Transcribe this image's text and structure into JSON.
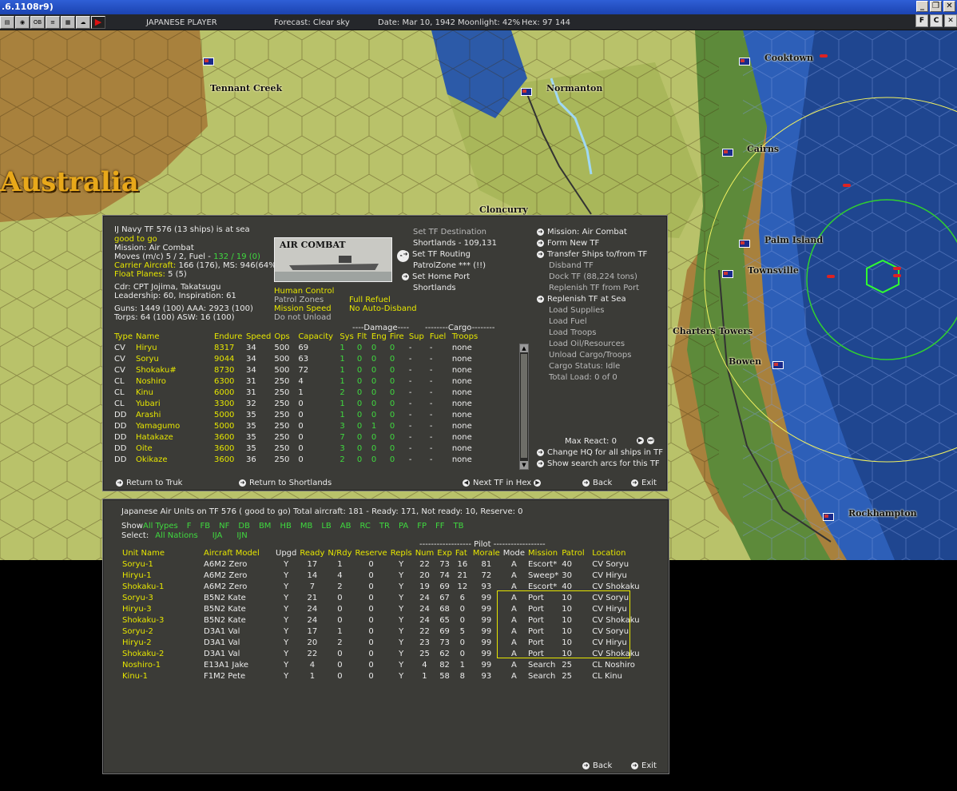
{
  "window": {
    "title": ".6.1108r9)",
    "buttons": [
      "_",
      "❐",
      "✕"
    ]
  },
  "toolbar": {
    "player": "JAPANESE PLAYER",
    "forecast": "Forecast: Clear sky",
    "date": "Date: Mar 10, 1942",
    "moonlight": "Moonlight: 42%",
    "hex": "Hex: 97 144",
    "right_buttons": [
      "F",
      "C",
      "✕"
    ]
  },
  "map": {
    "region_label": "Australia",
    "cities": [
      "Tennant Creek",
      "Normanton",
      "Cooktown",
      "Cairns",
      "Cloncurry",
      "Palm Island",
      "Townsville",
      "Charters Towers",
      "Bowen",
      "Rockhampton"
    ]
  },
  "tf": {
    "header": "IJ Navy TF 576 (13 ships) is at sea",
    "status": "good to go",
    "mission": "Mission: Air Combat",
    "moves_label": "Moves (m/c) 5 / 2, Fuel -",
    "moves_value": "132 / 19 (0)",
    "carrier_label": "Carrier Aircraft:",
    "carrier_value": "166 (176), MS: 946(64%)",
    "float_label": "Float Planes:",
    "float_value": "5 (5)",
    "cdr": "Cdr: CPT Jojima, Takatsugu",
    "leadership": "Leadership: 60, Inspiration: 61",
    "guns": "Guns: 1449 (100)  AAA: 2923 (100)",
    "torps": "Torps: 64 (100)     ASW: 16 (100)",
    "image_label": "AIR COMBAT",
    "human_control": "Human Control",
    "patrol_zones": "Patrol Zones",
    "full_refuel": "Full Refuel",
    "mission_speed": "Mission Speed",
    "no_auto_disband": "No Auto-Disband",
    "do_not_unload": "Do not Unload",
    "mid_cmds": [
      "Set TF Destination",
      "Shortlands - 109,131",
      "Set TF Routing",
      "PatrolZone *** (!!)",
      "Set Home Port",
      "Shortlands"
    ],
    "right_cmds": [
      "Mission: Air Combat",
      "Form New TF",
      "Transfer Ships to/from TF",
      "Disband TF",
      "Dock TF (88,224 tons)",
      "Replenish TF from Port",
      "Replenish TF at Sea",
      "Load Supplies",
      "Load Fuel",
      "Load Troops",
      "Load Oil/Resources",
      "Unload Cargo/Troops",
      "Cargo Status: Idle",
      "Total Load: 0 of 0"
    ],
    "max_react": "Max React: 0",
    "change_hq": "Change HQ for all ships in TF",
    "show_arcs": "Show search arcs for this TF",
    "damage_header": "----Damage----",
    "cargo_header": "--------Cargo--------",
    "columns": [
      "Type",
      "Name",
      "Endure",
      "Speed",
      "Ops",
      "Capacity",
      "Sys",
      "Flt",
      "Eng",
      "Fire",
      "Sup",
      "Fuel",
      "Troops"
    ],
    "ships": [
      [
        "CV",
        "Hiryu",
        "8317",
        "34",
        "500",
        "69",
        "1",
        "0",
        "0",
        "0",
        "-",
        "-",
        "none"
      ],
      [
        "CV",
        "Soryu",
        "9044",
        "34",
        "500",
        "63",
        "1",
        "0",
        "0",
        "0",
        "-",
        "-",
        "none"
      ],
      [
        "CV",
        "Shokaku#",
        "8730",
        "34",
        "500",
        "72",
        "1",
        "0",
        "0",
        "0",
        "-",
        "-",
        "none"
      ],
      [
        "CL",
        "Noshiro",
        "6300",
        "31",
        "250",
        "4",
        "1",
        "0",
        "0",
        "0",
        "-",
        "-",
        "none"
      ],
      [
        "CL",
        "Kinu",
        "6000",
        "31",
        "250",
        "1",
        "2",
        "0",
        "0",
        "0",
        "-",
        "-",
        "none"
      ],
      [
        "CL",
        "Yubari",
        "3300",
        "32",
        "250",
        "0",
        "1",
        "0",
        "0",
        "0",
        "-",
        "-",
        "none"
      ],
      [
        "DD",
        "Arashi",
        "5000",
        "35",
        "250",
        "0",
        "1",
        "0",
        "0",
        "0",
        "-",
        "-",
        "none"
      ],
      [
        "DD",
        "Yamagumo",
        "5000",
        "35",
        "250",
        "0",
        "3",
        "0",
        "1",
        "0",
        "-",
        "-",
        "none"
      ],
      [
        "DD",
        "Hatakaze",
        "3600",
        "35",
        "250",
        "0",
        "7",
        "0",
        "0",
        "0",
        "-",
        "-",
        "none"
      ],
      [
        "DD",
        "Oite",
        "3600",
        "35",
        "250",
        "0",
        "3",
        "0",
        "0",
        "0",
        "-",
        "-",
        "none"
      ],
      [
        "DD",
        "Okikaze",
        "3600",
        "36",
        "250",
        "0",
        "2",
        "0",
        "0",
        "0",
        "-",
        "-",
        "none"
      ]
    ],
    "bottom": {
      "return_truk": "Return to Truk",
      "return_shortlands": "Return to Shortlands",
      "next_tf": "Next TF in Hex",
      "back": "Back",
      "exit": "Exit"
    }
  },
  "air": {
    "header": "Japanese Air Units on TF 576 ( good to go)  Total aircraft: 181 - Ready: 171, Not ready: 10, Reserve: 0",
    "show_label": "Show",
    "types": [
      "All Types",
      "F",
      "FB",
      "NF",
      "DB",
      "BM",
      "HB",
      "MB",
      "LB",
      "AB",
      "RC",
      "TR",
      "PA",
      "FP",
      "FF",
      "TB"
    ],
    "select_label": "Select:",
    "nations": [
      "All Nations",
      "IJA",
      "IJN"
    ],
    "pilot_header": "------------------ Pilot ------------------",
    "columns": [
      "Unit Name",
      "Aircraft Model",
      "Upgd",
      "Ready",
      "N/Rdy",
      "Reserve",
      "Repls",
      "Num",
      "Exp",
      "Fat",
      "Morale",
      "Mode",
      "Mission",
      "Patrol",
      "Location"
    ],
    "units": [
      [
        "Soryu-1",
        "A6M2 Zero",
        "Y",
        "17",
        "1",
        "0",
        "Y",
        "22",
        "73",
        "16",
        "81",
        "A",
        "Escort*",
        "40",
        "CV Soryu"
      ],
      [
        "Hiryu-1",
        "A6M2 Zero",
        "Y",
        "14",
        "4",
        "0",
        "Y",
        "20",
        "74",
        "21",
        "72",
        "A",
        "Sweep*",
        "30",
        "CV Hiryu"
      ],
      [
        "Shokaku-1",
        "A6M2 Zero",
        "Y",
        "7",
        "2",
        "0",
        "Y",
        "19",
        "69",
        "12",
        "93",
        "A",
        "Escort*",
        "40",
        "CV Shokaku"
      ],
      [
        "Soryu-3",
        "B5N2 Kate",
        "Y",
        "21",
        "0",
        "0",
        "Y",
        "24",
        "67",
        "6",
        "99",
        "A",
        "Port",
        "10",
        "CV Soryu"
      ],
      [
        "Hiryu-3",
        "B5N2 Kate",
        "Y",
        "24",
        "0",
        "0",
        "Y",
        "24",
        "68",
        "0",
        "99",
        "A",
        "Port",
        "10",
        "CV Hiryu"
      ],
      [
        "Shokaku-3",
        "B5N2 Kate",
        "Y",
        "24",
        "0",
        "0",
        "Y",
        "24",
        "65",
        "0",
        "99",
        "A",
        "Port",
        "10",
        "CV Shokaku"
      ],
      [
        "Soryu-2",
        "D3A1 Val",
        "Y",
        "17",
        "1",
        "0",
        "Y",
        "22",
        "69",
        "5",
        "99",
        "A",
        "Port",
        "10",
        "CV Soryu"
      ],
      [
        "Hiryu-2",
        "D3A1 Val",
        "Y",
        "20",
        "2",
        "0",
        "Y",
        "23",
        "73",
        "0",
        "99",
        "A",
        "Port",
        "10",
        "CV Hiryu"
      ],
      [
        "Shokaku-2",
        "D3A1 Val",
        "Y",
        "22",
        "0",
        "0",
        "Y",
        "25",
        "62",
        "0",
        "99",
        "A",
        "Port",
        "10",
        "CV Shokaku"
      ],
      [
        "Noshiro-1",
        "E13A1 Jake",
        "Y",
        "4",
        "0",
        "0",
        "Y",
        "4",
        "82",
        "1",
        "99",
        "A",
        "Search",
        "25",
        "CL Noshiro"
      ],
      [
        "Kinu-1",
        "F1M2 Pete",
        "Y",
        "1",
        "0",
        "0",
        "Y",
        "1",
        "58",
        "8",
        "93",
        "A",
        "Search",
        "25",
        "CL Kinu"
      ]
    ],
    "back": "Back",
    "exit": "Exit"
  }
}
